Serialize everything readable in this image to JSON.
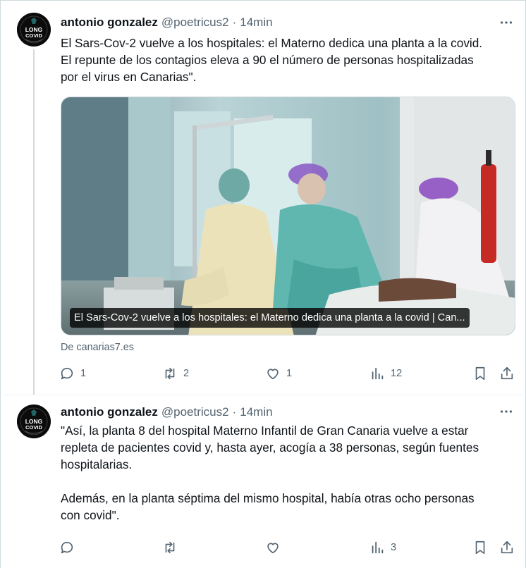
{
  "tweets": [
    {
      "author": {
        "name": "antonio gonzalez",
        "handle": "@poetricus2",
        "avatar_text": [
          "LONG",
          "COVID"
        ]
      },
      "separator": "·",
      "time": "14min",
      "text": "El Sars-Cov-2 vuelve a los hospitales: el Materno dedica una planta a la covid.\nEl repunte de los contagios eleva a 90 el número de personas hospitalizadas\npor el virus en Canarias\".",
      "card": {
        "caption": "El Sars-Cov-2 vuelve a los hospitales: el Materno dedica una planta a la covid | Can...",
        "source": "De canarias7.es"
      },
      "actions": {
        "replies": "1",
        "retweets": "2",
        "likes": "1",
        "views": "12"
      }
    },
    {
      "author": {
        "name": "antonio gonzalez",
        "handle": "@poetricus2",
        "avatar_text": [
          "LONG",
          "COVID"
        ]
      },
      "separator": "·",
      "time": "14min",
      "text": "\"Así, la planta 8 del hospital Materno Infantil de Gran Canaria vuelve a estar\nrepleta de pacientes covid y, hasta ayer, acogía a 38 personas, según fuentes\nhospitalarias.\n\n Además, en la planta séptima del mismo hospital, había otras ocho personas\ncon covid\".",
      "actions": {
        "replies": "",
        "retweets": "",
        "likes": "",
        "views": "3"
      }
    }
  ],
  "icons": {
    "more": "more-horizontal-icon",
    "reply": "reply-icon",
    "retweet": "retweet-icon",
    "like": "heart-icon",
    "views": "views-icon",
    "bookmark": "bookmark-icon",
    "share": "share-icon"
  },
  "colors": {
    "text": "#0f1419",
    "secondary": "#536471",
    "border": "#cfd9de"
  }
}
